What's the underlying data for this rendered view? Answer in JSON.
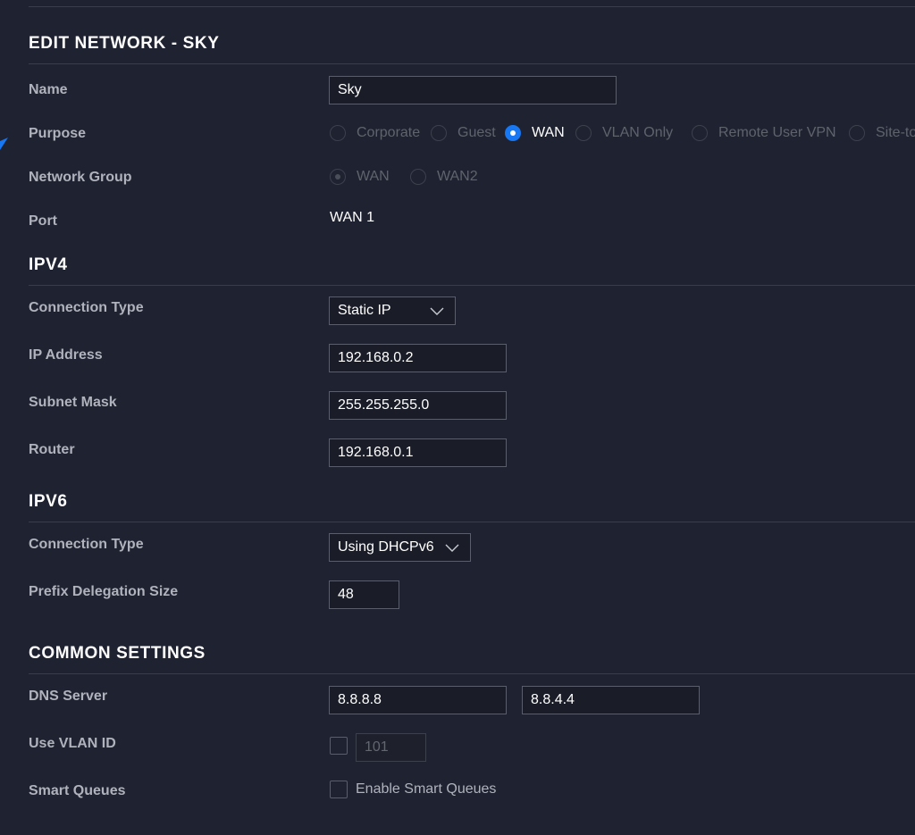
{
  "header": {
    "title": "EDIT NETWORK - SKY"
  },
  "fields": {
    "name": {
      "label": "Name",
      "value": "Sky"
    },
    "purpose": {
      "label": "Purpose",
      "options": [
        "Corporate",
        "Guest",
        "WAN",
        "VLAN Only",
        "Remote User VPN",
        "Site-to"
      ],
      "selected": "WAN"
    },
    "network_group": {
      "label": "Network Group",
      "options": [
        "WAN",
        "WAN2"
      ],
      "selected": "WAN"
    },
    "port": {
      "label": "Port",
      "value": "WAN 1"
    }
  },
  "ipv4": {
    "title": "IPV4",
    "connection_type": {
      "label": "Connection Type",
      "value": "Static IP"
    },
    "ip_address": {
      "label": "IP Address",
      "value": "192.168.0.2"
    },
    "subnet_mask": {
      "label": "Subnet Mask",
      "value": "255.255.255.0"
    },
    "router": {
      "label": "Router",
      "value": "192.168.0.1"
    }
  },
  "ipv6": {
    "title": "IPV6",
    "connection_type": {
      "label": "Connection Type",
      "value": "Using DHCPv6"
    },
    "prefix_delegation_size": {
      "label": "Prefix Delegation Size",
      "value": "48"
    }
  },
  "common": {
    "title": "COMMON SETTINGS",
    "dns_server": {
      "label": "DNS Server",
      "primary": "8.8.8.8",
      "secondary": "8.8.4.4"
    },
    "vlan": {
      "label": "Use VLAN ID",
      "value": "101",
      "checked": false
    },
    "smart_queues": {
      "label": "Smart Queues",
      "checkbox_label": "Enable Smart Queues",
      "checked": false
    }
  },
  "colors": {
    "background": "#1f2230",
    "accent": "#1877f2",
    "divider": "#3a3e4c",
    "input_border": "#5a5e6c"
  }
}
